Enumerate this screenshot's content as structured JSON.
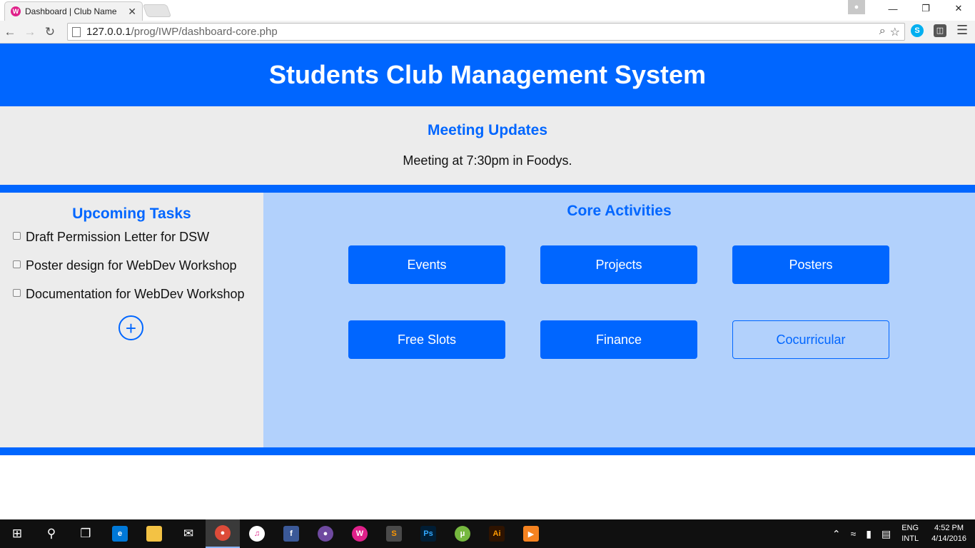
{
  "browser": {
    "tab_title": "Dashboard | Club Name",
    "tab_close": "✕",
    "url_host": "127.0.0.1",
    "url_path": "/prog/IWP/dashboard-core.php"
  },
  "header": {
    "title": "Students Club Management System"
  },
  "meeting": {
    "title": "Meeting Updates",
    "text": "Meeting at 7:30pm in Foodys."
  },
  "tasks": {
    "title": "Upcoming Tasks",
    "items": [
      {
        "label": "Draft Permission Letter for DSW",
        "checked": false
      },
      {
        "label": "Poster design for WebDev Workshop",
        "checked": false
      },
      {
        "label": "Documentation for WebDev Workshop",
        "checked": false
      }
    ],
    "add_symbol": "+"
  },
  "activities": {
    "title": "Core Activities",
    "buttons": [
      "Events",
      "Projects",
      "Posters",
      "Free Slots",
      "Finance",
      "Cocurricular"
    ],
    "selected": "Cocurricular"
  },
  "taskbar": {
    "apps": [
      "windows-start",
      "search",
      "task-view",
      "edge",
      "file-explorer",
      "mail",
      "chrome",
      "itunes",
      "facebook",
      "cat-app",
      "wamp",
      "sublime-text",
      "photoshop",
      "utorrent",
      "illustrator",
      "media-player"
    ],
    "active_app": "chrome",
    "language": "ENG",
    "layout": "INTL",
    "time": "4:52 PM",
    "date": "4/14/2016"
  },
  "colors": {
    "primary": "#0066ff",
    "light_panel": "#ececec",
    "activity_bg": "#b2d1fc"
  }
}
